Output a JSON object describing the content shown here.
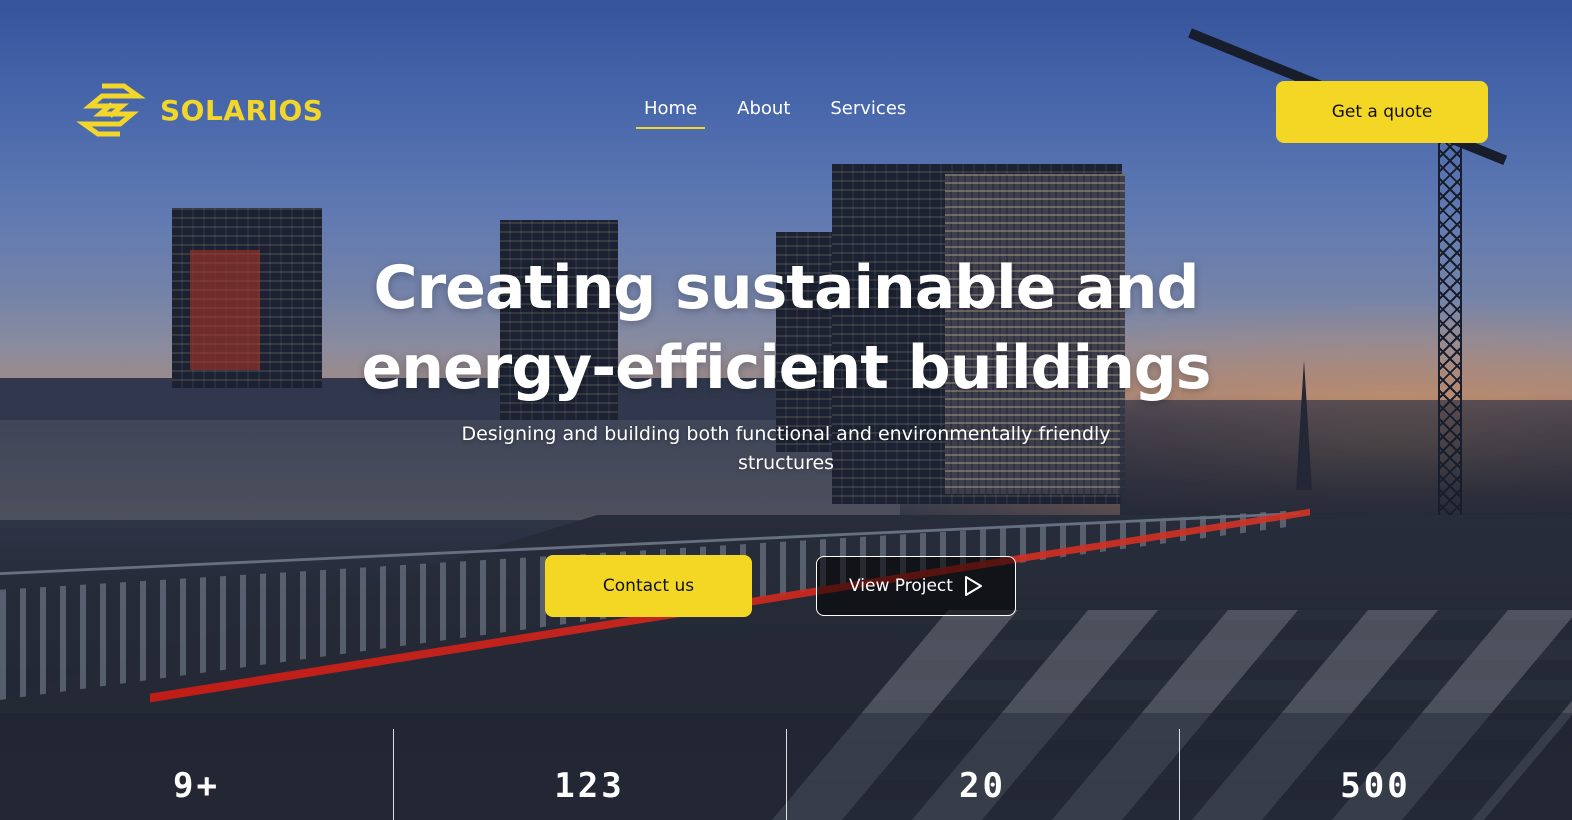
{
  "brand": {
    "name": "SOLARIOS",
    "accent_color": "#f3d724",
    "logo_icon": "solarios-logo-icon"
  },
  "nav": {
    "items": [
      {
        "label": "Home",
        "active": true
      },
      {
        "label": "About",
        "active": false
      },
      {
        "label": "Services",
        "active": false
      }
    ]
  },
  "header": {
    "cta_label": "Get a quote"
  },
  "hero": {
    "title_line1": "Creating sustainable and",
    "title_line2": "energy-efficient buildings",
    "subtitle": "Designing and building both functional and environmentally friendly structures",
    "primary_cta": "Contact us",
    "secondary_cta": "View Project",
    "secondary_cta_icon": "play-icon"
  },
  "stats": [
    {
      "value": "9+"
    },
    {
      "value": "123"
    },
    {
      "value": "20"
    },
    {
      "value": "500"
    }
  ]
}
